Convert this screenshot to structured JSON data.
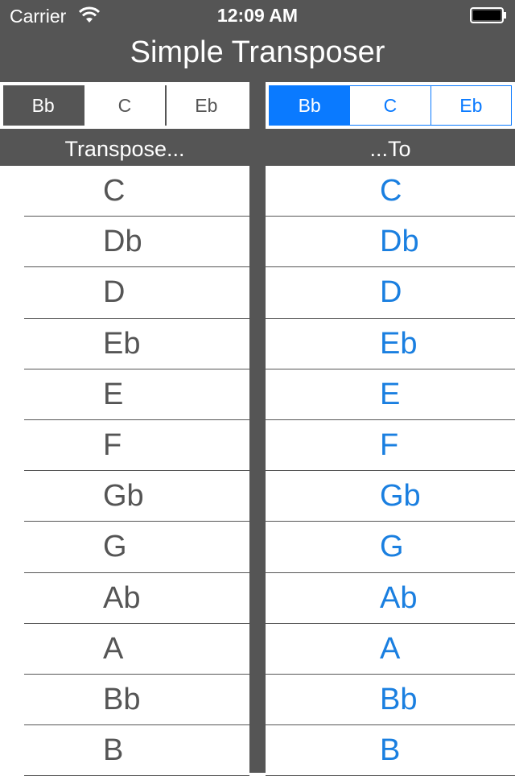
{
  "status": {
    "carrier": "Carrier",
    "time": "12:09 AM",
    "icons": [
      "wifi-icon",
      "battery-icon"
    ]
  },
  "app": {
    "title": "Simple Transposer"
  },
  "from_selector": {
    "options": [
      "Bb",
      "C",
      "Eb"
    ],
    "selected": "Bb"
  },
  "to_selector": {
    "options": [
      "Bb",
      "C",
      "Eb"
    ],
    "selected": "Bb"
  },
  "headers": {
    "from": "Transpose...",
    "to": "...To"
  },
  "notes_from": [
    "C",
    "Db",
    "D",
    "Eb",
    "E",
    "F",
    "Gb",
    "G",
    "Ab",
    "A",
    "Bb",
    "B"
  ],
  "notes_to": [
    "C",
    "Db",
    "D",
    "Eb",
    "E",
    "F",
    "Gb",
    "G",
    "Ab",
    "A",
    "Bb",
    "B"
  ],
  "colors": {
    "chrome": "#555555",
    "accent": "#0a7aff",
    "note_to_text": "#1a7fe0"
  }
}
